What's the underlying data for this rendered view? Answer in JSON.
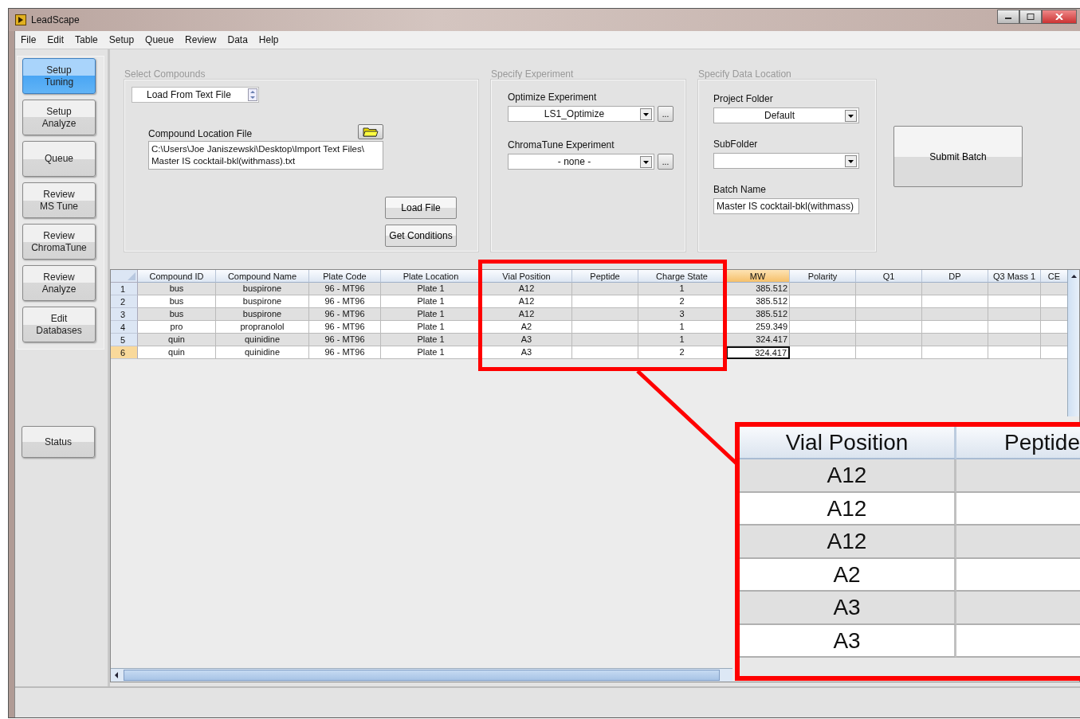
{
  "window": {
    "title": "LeadScape"
  },
  "menu": [
    "File",
    "Edit",
    "Table",
    "Setup",
    "Queue",
    "Review",
    "Data",
    "Help"
  ],
  "sidebar": {
    "buttons": [
      {
        "label": "Setup\nTuning",
        "selected": true
      },
      {
        "label": "Setup\nAnalyze",
        "selected": false
      },
      {
        "label": "Queue",
        "selected": false
      },
      {
        "label": "Review\nMS Tune",
        "selected": false
      },
      {
        "label": "Review\nChromaTune",
        "selected": false
      },
      {
        "label": "Review\nAnalyze",
        "selected": false
      },
      {
        "label": "Edit\nDatabases",
        "selected": false
      }
    ],
    "status_button": "Status"
  },
  "select_compounds": {
    "title": "Select Compounds",
    "source": "Load From Text File",
    "file_label": "Compound Location File",
    "file_path": "C:\\Users\\Joe Janiszewski\\Desktop\\Import Text Files\\\nMaster IS cocktail-bkl(withmass).txt",
    "buttons": [
      "Load File",
      "Get Conditions"
    ]
  },
  "specify_experiment": {
    "title": "Specify Experiment",
    "fields": [
      {
        "label": "Optimize Experiment",
        "value": "LS1_Optimize",
        "browse": "..."
      },
      {
        "label": "ChromaTune Experiment",
        "value": "- none -",
        "browse": "..."
      }
    ]
  },
  "data_location": {
    "title": "Specify Data Location",
    "project_folder": {
      "label": "Project Folder",
      "value": "Default"
    },
    "subfolder": {
      "label": "SubFolder"
    },
    "batch_name": {
      "label": "Batch Name",
      "value": "Master IS cocktail-bkl(withmass)"
    }
  },
  "submit_button": "Submit Batch",
  "table": {
    "columns": [
      {
        "label": "Compound ID",
        "kind": "text",
        "selected": false
      },
      {
        "label": "Compound Name",
        "kind": "text",
        "selected": false
      },
      {
        "label": "Plate Code",
        "kind": "text",
        "selected": false
      },
      {
        "label": "Plate Location",
        "kind": "text",
        "selected": false
      },
      {
        "label": "Vial Position",
        "kind": "text",
        "selected": false
      },
      {
        "label": "Peptide",
        "kind": "text",
        "selected": false
      },
      {
        "label": "Charge State",
        "kind": "text",
        "selected": false
      },
      {
        "label": "MW",
        "kind": "number",
        "selected": true
      },
      {
        "label": "Polarity",
        "kind": "text",
        "selected": false
      },
      {
        "label": "Q1",
        "kind": "text",
        "selected": false
      },
      {
        "label": "DP",
        "kind": "text",
        "selected": false
      },
      {
        "label": "Q3 Mass 1",
        "kind": "text",
        "selected": false
      },
      {
        "label": "CE",
        "kind": "text",
        "selected": false
      }
    ],
    "rows": [
      {
        "number": "1",
        "selected": false,
        "cells": [
          "bus",
          "buspirone",
          "96 - MT96",
          "Plate 1",
          "A12",
          null,
          "1",
          "385.512",
          null,
          null,
          null,
          null,
          null
        ]
      },
      {
        "number": "2",
        "selected": false,
        "cells": [
          "bus",
          "buspirone",
          "96 - MT96",
          "Plate 1",
          "A12",
          null,
          "2",
          "385.512",
          null,
          null,
          null,
          null,
          null
        ]
      },
      {
        "number": "3",
        "selected": false,
        "cells": [
          "bus",
          "buspirone",
          "96 - MT96",
          "Plate 1",
          "A12",
          null,
          "3",
          "385.512",
          null,
          null,
          null,
          null,
          null
        ]
      },
      {
        "number": "4",
        "selected": false,
        "cells": [
          "pro",
          "propranolol",
          "96 - MT96",
          "Plate 1",
          "A2",
          null,
          "1",
          "259.349",
          null,
          null,
          null,
          null,
          null
        ]
      },
      {
        "number": "5",
        "selected": false,
        "cells": [
          "quin",
          "quinidine",
          "96 - MT96",
          "Plate 1",
          "A3",
          null,
          "1",
          "324.417",
          null,
          null,
          null,
          null,
          null
        ]
      },
      {
        "number": "6",
        "selected": true,
        "cells": [
          "quin",
          "quinidine",
          "96 - MT96",
          "Plate 1",
          "A3",
          null,
          "2",
          "324.417",
          null,
          null,
          null,
          null,
          null
        ]
      }
    ]
  },
  "callout": {
    "columns": [
      "Vial Position",
      "Peptide"
    ],
    "values": [
      "A12",
      "A12",
      "A12",
      "A2",
      "A3",
      "A3"
    ]
  }
}
